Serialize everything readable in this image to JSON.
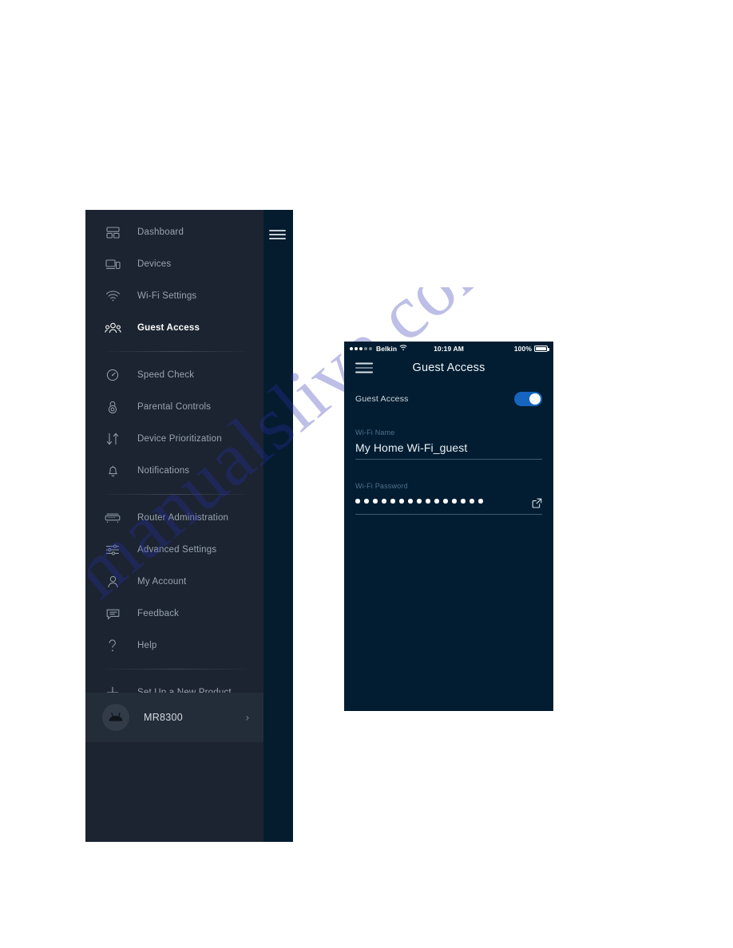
{
  "watermark": {
    "text": "manualslive.com"
  },
  "sidebar": {
    "hamburger_icon": "hamburger-menu-icon",
    "groups": [
      {
        "items": [
          {
            "label": "Dashboard",
            "icon": "dashboard-icon",
            "active": false
          },
          {
            "label": "Devices",
            "icon": "devices-icon",
            "active": false
          },
          {
            "label": "Wi-Fi Settings",
            "icon": "wifi-icon",
            "active": false
          },
          {
            "label": "Guest Access",
            "icon": "guests-icon",
            "active": true
          }
        ]
      },
      {
        "items": [
          {
            "label": "Speed Check",
            "icon": "speedometer-icon",
            "active": false
          },
          {
            "label": "Parental Controls",
            "icon": "lock-icon",
            "active": false
          },
          {
            "label": "Device Prioritization",
            "icon": "arrows-updown-icon",
            "active": false
          },
          {
            "label": "Notifications",
            "icon": "bell-icon",
            "active": false
          }
        ]
      },
      {
        "items": [
          {
            "label": "Router Administration",
            "icon": "router-icon",
            "active": false
          },
          {
            "label": "Advanced Settings",
            "icon": "sliders-icon",
            "active": false
          },
          {
            "label": "My Account",
            "icon": "person-icon",
            "active": false
          },
          {
            "label": "Feedback",
            "icon": "chat-icon",
            "active": false
          },
          {
            "label": "Help",
            "icon": "question-icon",
            "active": false
          }
        ]
      },
      {
        "items": [
          {
            "label": "Set Up a New Product",
            "icon": "plus-icon",
            "active": false
          }
        ]
      }
    ],
    "router": {
      "name": "MR8300",
      "avatar_icon": "router-device-icon",
      "chevron_icon": "chevron-right-icon"
    }
  },
  "phone": {
    "status_bar": {
      "signal_icon": "signal-dots-icon",
      "carrier": "Belkin",
      "wifi_icon": "wifi-icon",
      "time": "10:19 AM",
      "battery_percent": "100%",
      "battery_icon": "battery-full-icon"
    },
    "header": {
      "menu_icon": "hamburger-menu-icon",
      "title": "Guest Access"
    },
    "guest_toggle": {
      "label": "Guest Access",
      "state": "on",
      "accent_color": "#1565c0"
    },
    "wifi_name": {
      "label": "Wi-Fi Name",
      "value": "My Home Wi-Fi_guest"
    },
    "wifi_password": {
      "label": "Wi-Fi Password",
      "masked_value": "•••••••••••••••",
      "dot_count": 15,
      "share_icon": "share-external-icon"
    }
  },
  "colors": {
    "sidebar_bg": "#1b2430",
    "sidebar_strip": "#041c2e",
    "phone_bg": "#021d31",
    "accent": "#1565c0",
    "muted_text": "#9aa4b0"
  }
}
